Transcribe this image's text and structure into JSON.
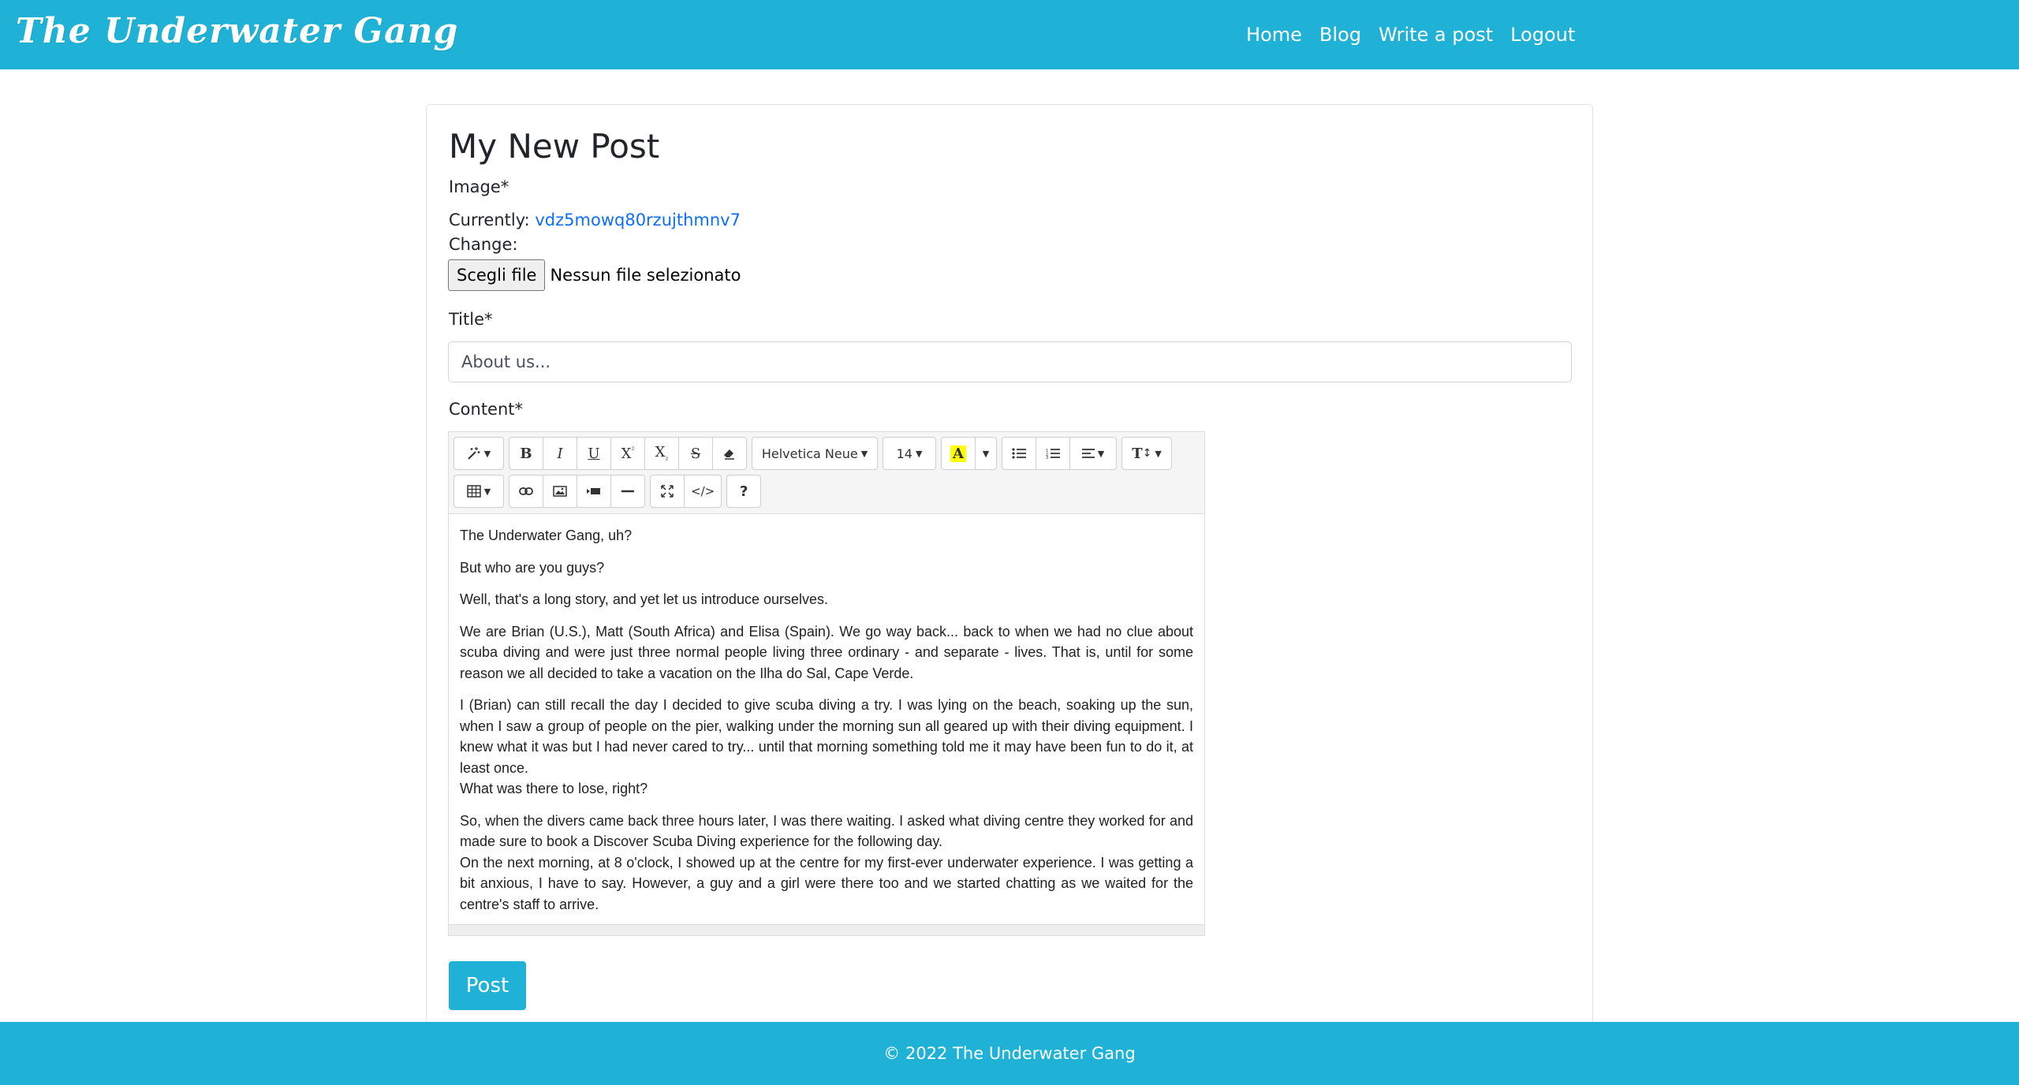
{
  "navbar": {
    "brand": "The Underwater Gang",
    "links": [
      "Home",
      "Blog",
      "Write a post",
      "Logout"
    ]
  },
  "form": {
    "page_title": "My New Post",
    "image_label": "Image*",
    "currently_label": "Currently:",
    "current_file": "vdz5mowq80rzujthmnv7",
    "change_label": "Change:",
    "file_button": "Scegli file",
    "file_status": "Nessun file selezionato",
    "title_label": "Title*",
    "title_value": "About us...",
    "content_label": "Content*",
    "post_button": "Post"
  },
  "toolbar": {
    "font_name": "Helvetica Neue",
    "font_size": "14",
    "highlight_glyph": "A",
    "help_glyph": "?"
  },
  "content": {
    "paragraphs": [
      "The Underwater Gang, uh?",
      "But who are you guys?",
      "Well, that's a long story, and yet let us introduce ourselves.",
      "We are Brian (U.S.), Matt (South Africa) and Elisa (Spain). We go way back... back to when we had no clue about scuba diving and were just three normal people living three ordinary - and separate - lives. That is, until for some reason we all decided to take a vacation on the Ilha do Sal, Cape Verde.",
      "I (Brian) can still recall the day I decided to give scuba diving a try. I was lying on the beach, soaking up the sun, when I saw a group of people on the pier, walking under the morning sun all geared up with their diving equipment. I knew what it was but I had never cared to try... until that morning something told me it may have been fun to do it, at least once.",
      "What was there to lose, right?",
      "So, when the divers came back three hours later, I was there waiting. I asked what diving centre they worked for and made sure to book a Discover Scuba Diving experience for the following day.",
      " On the next morning, at 8 o'clock, I showed up at the centre for my first-ever underwater experience. I was getting a bit anxious, I have to say. However, a guy and a girl were there too and we started chatting as we waited for the centre's staff to arrive."
    ]
  },
  "footer": {
    "text": "© 2022 The Underwater Gang"
  },
  "colors": {
    "brand": "#1fb2d6",
    "link": "#0d6efd"
  }
}
